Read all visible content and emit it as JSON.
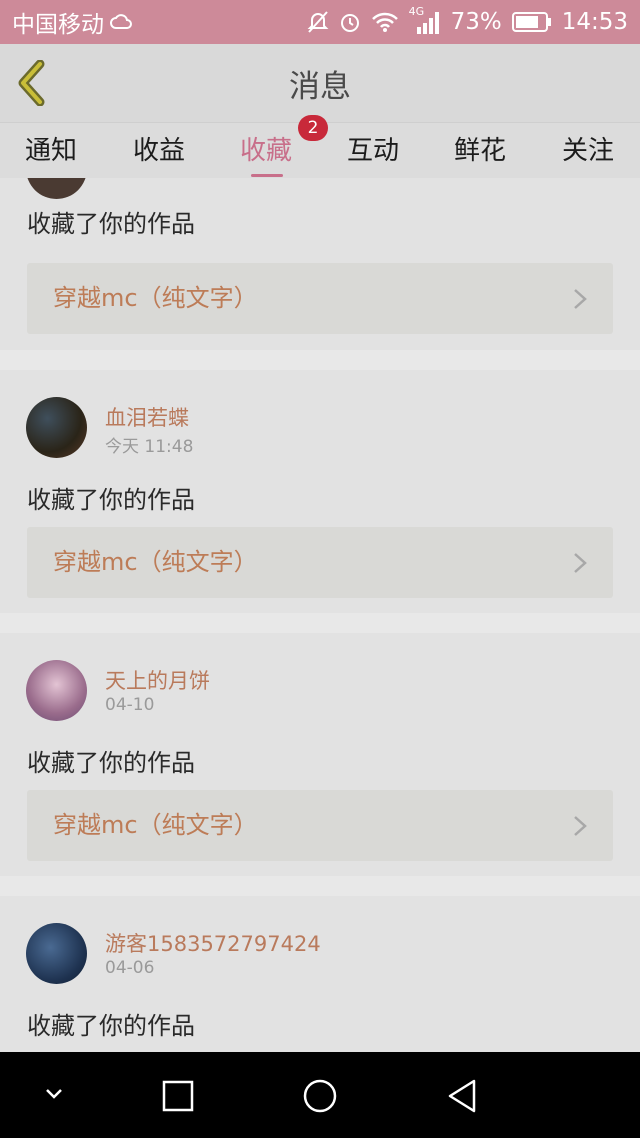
{
  "status_bar": {
    "carrier": "中国移动",
    "network": "4G",
    "battery": "73%",
    "time": "14:53"
  },
  "header": {
    "title": "消息"
  },
  "tabs": [
    {
      "label": "通知"
    },
    {
      "label": "收益"
    },
    {
      "label": "收藏",
      "badge": "2",
      "active": true
    },
    {
      "label": "互动"
    },
    {
      "label": "鲜花"
    },
    {
      "label": "关注"
    }
  ],
  "feed": {
    "items": [
      {
        "user": "",
        "time": "",
        "action": "收藏了你的作品",
        "work": "穿越mc（纯文字）"
      },
      {
        "user": "血泪若蝶",
        "time": "今天 11:48",
        "action": "收藏了你的作品",
        "work": "穿越mc（纯文字）"
      },
      {
        "user": "天上的月饼",
        "time": "04-10",
        "action": "收藏了你的作品",
        "work": "穿越mc（纯文字）"
      },
      {
        "user": "游客1583572797424",
        "time": "04-06",
        "action": "收藏了你的作品",
        "work": ""
      }
    ]
  },
  "colors": {
    "accent": "#c86f8a",
    "badge": "#c8293a",
    "username": "#b97a5c",
    "status_bar": "#cd8a99"
  }
}
